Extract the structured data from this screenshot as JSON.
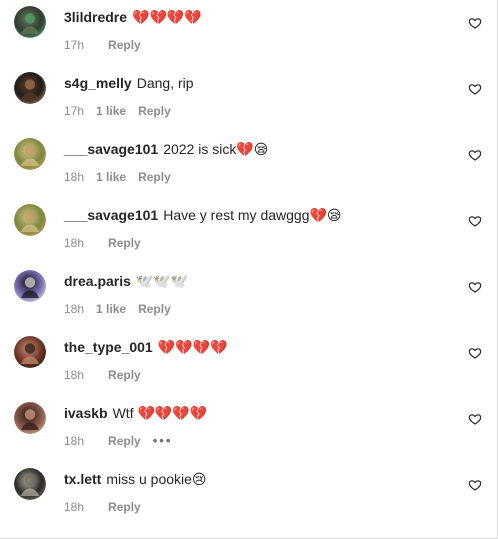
{
  "comments": [
    {
      "username": "3lildredre",
      "text": "💔💔💔💔",
      "time": "17h",
      "likes": "",
      "reply": "Reply",
      "more": "",
      "avatar_colors": [
        "#6b7a57",
        "#2d3b31",
        "#4aa56a"
      ]
    },
    {
      "username": "s4g_melly",
      "text": "Dang, rip",
      "time": "17h",
      "likes": "1 like",
      "reply": "Reply",
      "more": "",
      "avatar_colors": [
        "#5f3a22",
        "#1f1d1b",
        "#9e7552"
      ]
    },
    {
      "username": "___savage101",
      "text": "2022 is sick💔😪",
      "time": "18h",
      "likes": "1 like",
      "reply": "Reply",
      "more": "",
      "avatar_colors": [
        "#d9c28c",
        "#7b8a3b",
        "#bf9b5f"
      ]
    },
    {
      "username": "___savage101",
      "text": "Have y rest my dawggg💔😪",
      "time": "18h",
      "likes": "",
      "reply": "Reply",
      "more": "",
      "avatar_colors": [
        "#d9c28c",
        "#7b8a3b",
        "#bf9b5f"
      ]
    },
    {
      "username": "drea.paris",
      "text": "🕊️🕊️🕊️",
      "time": "18h",
      "likes": "1 like",
      "reply": "Reply",
      "more": "",
      "avatar_colors": [
        "#0f0f0f",
        "#7e6fb7",
        "#d9d9d9"
      ]
    },
    {
      "username": "the_type_001",
      "text": "💔💔💔💔",
      "time": "18h",
      "likes": "",
      "reply": "Reply",
      "more": "",
      "avatar_colors": [
        "#c58d72",
        "#6b3426",
        "#2a1813"
      ]
    },
    {
      "username": "ivaskb",
      "text": "Wtf 💔💔💔💔",
      "time": "18h",
      "likes": "",
      "reply": "Reply",
      "more": "•••",
      "avatar_colors": [
        "#2a1a17",
        "#8b5a4a",
        "#d4a58a"
      ]
    },
    {
      "username": "tx.lett",
      "text": "miss u pookie😢",
      "time": "18h",
      "likes": "",
      "reply": "Reply",
      "more": "",
      "avatar_colors": [
        "#b9b2a5",
        "#2c2b29",
        "#6f6a63"
      ]
    }
  ]
}
